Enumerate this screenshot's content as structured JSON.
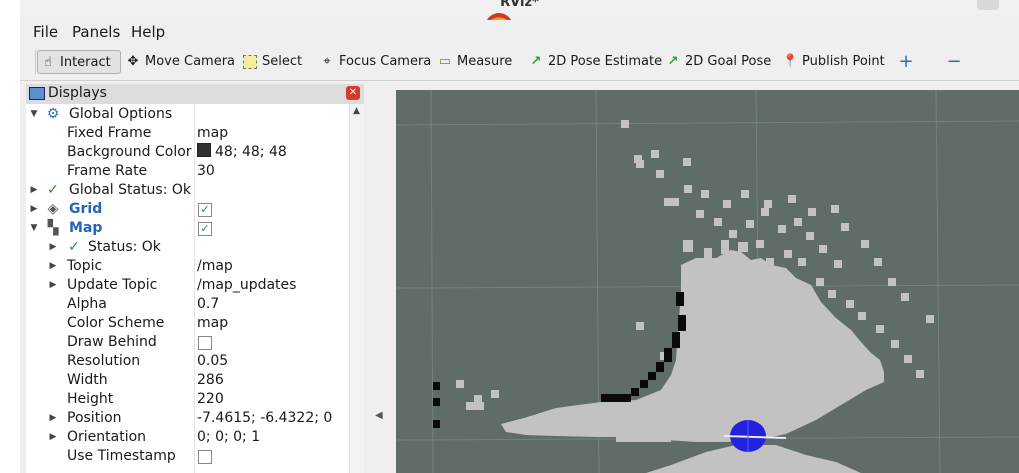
{
  "window": {
    "title": "RViz*",
    "minimize_label": "–"
  },
  "menu": {
    "file_label": "File",
    "panels_label": "Panels",
    "help_label": "Help"
  },
  "toolbar": {
    "interact": "Interact",
    "move_camera": "Move Camera",
    "select": "Select",
    "focus_camera": "Focus Camera",
    "measure": "Measure",
    "pose_estimate": "2D Pose Estimate",
    "goal_pose": "2D Goal Pose",
    "publish_point": "Publish Point",
    "add_glyph": "+",
    "remove_glyph": "−"
  },
  "displays": {
    "title": "Displays",
    "close_glyph": "✕",
    "global_options": {
      "label": "Global Options",
      "fixed_frame_label": "Fixed Frame",
      "fixed_frame": "map",
      "background_color_label": "Background Color",
      "background_color": "48; 48; 48",
      "background_color_hex": "#303030",
      "frame_rate_label": "Frame Rate",
      "frame_rate": "30"
    },
    "global_status": "Global Status: Ok",
    "grid": {
      "label": "Grid",
      "enabled": true
    },
    "map": {
      "label": "Map",
      "enabled": true,
      "status": "Status: Ok",
      "topic_label": "Topic",
      "topic": "/map",
      "update_topic_label": "Update Topic",
      "update_topic": "/map_updates",
      "alpha_label": "Alpha",
      "alpha": "0.7",
      "color_scheme_label": "Color Scheme",
      "color_scheme": "map",
      "draw_behind_label": "Draw Behind",
      "draw_behind": false,
      "resolution_label": "Resolution",
      "resolution": "0.05",
      "width_label": "Width",
      "width": "286",
      "height_label": "Height",
      "height": "220",
      "position_label": "Position",
      "position": "-7.4615; -6.4322; 0",
      "orientation_label": "Orientation",
      "orientation": "0; 0; 0; 1",
      "use_timestamp_label": "Use Timestamp",
      "use_timestamp": false
    }
  },
  "colors": {
    "viewport_bg": "#5f6c6a",
    "free_space": "#c2c2c2",
    "occupied": "#0a0a0a",
    "robot": "#2222dd",
    "accent_blue": "#2266bb"
  }
}
